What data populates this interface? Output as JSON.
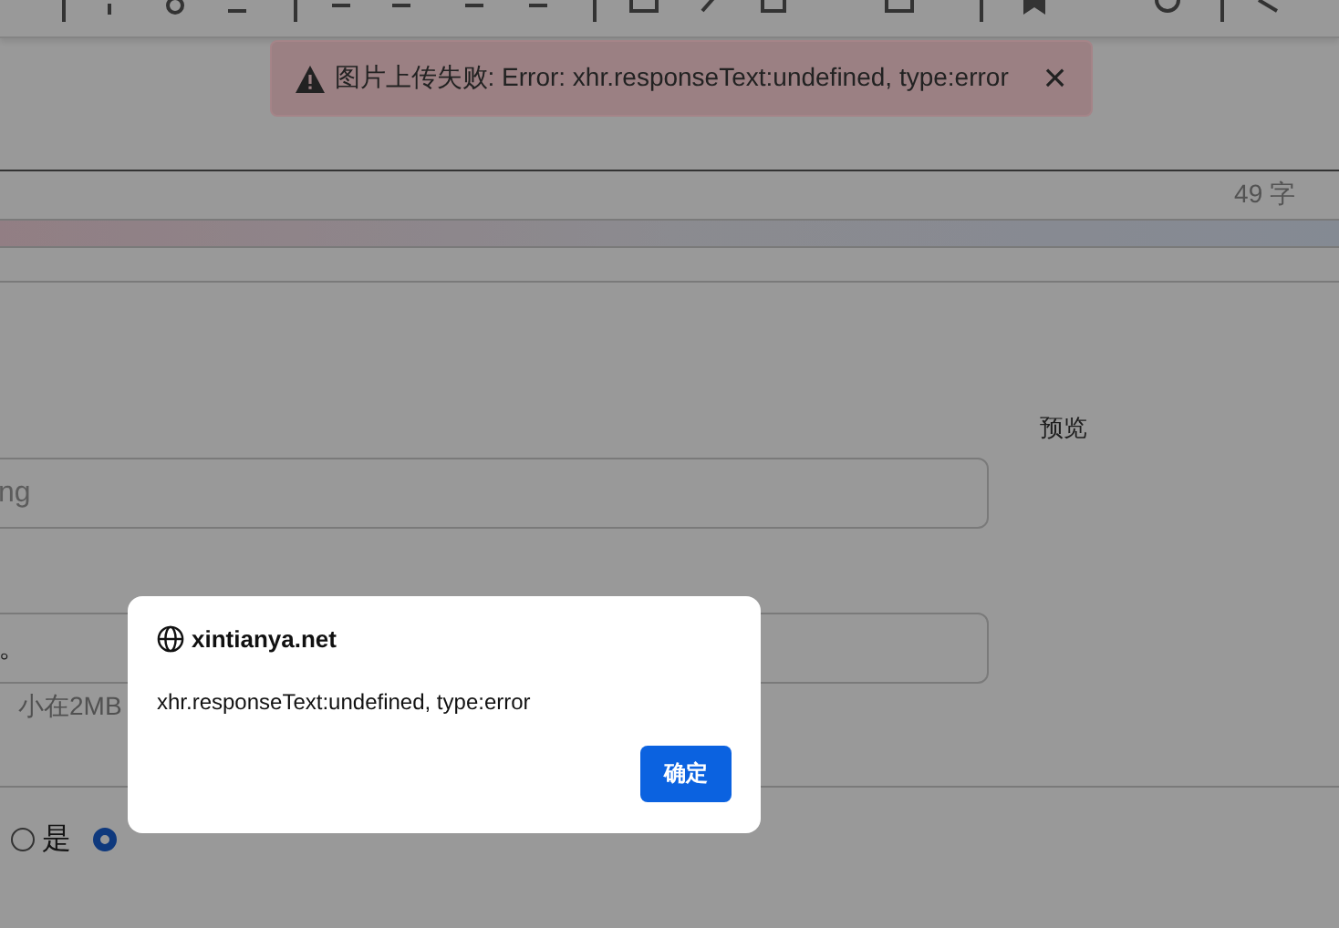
{
  "toast": {
    "message": "图片上传失败: Error: xhr.responseText:undefined, type:error",
    "close": "×"
  },
  "editor": {
    "word_count": "49 字"
  },
  "form": {
    "preview": "预览",
    "field_1": {
      "placeholder": "ng"
    },
    "field_2": {
      "value": "。"
    },
    "hint": "小在2MB",
    "radios": [
      {
        "label": "是",
        "selected": false
      },
      {
        "selected": true
      }
    ]
  },
  "dialog": {
    "title": "xintianya.net",
    "message": "xhr.responseText:undefined, type:error",
    "button": "确定"
  }
}
